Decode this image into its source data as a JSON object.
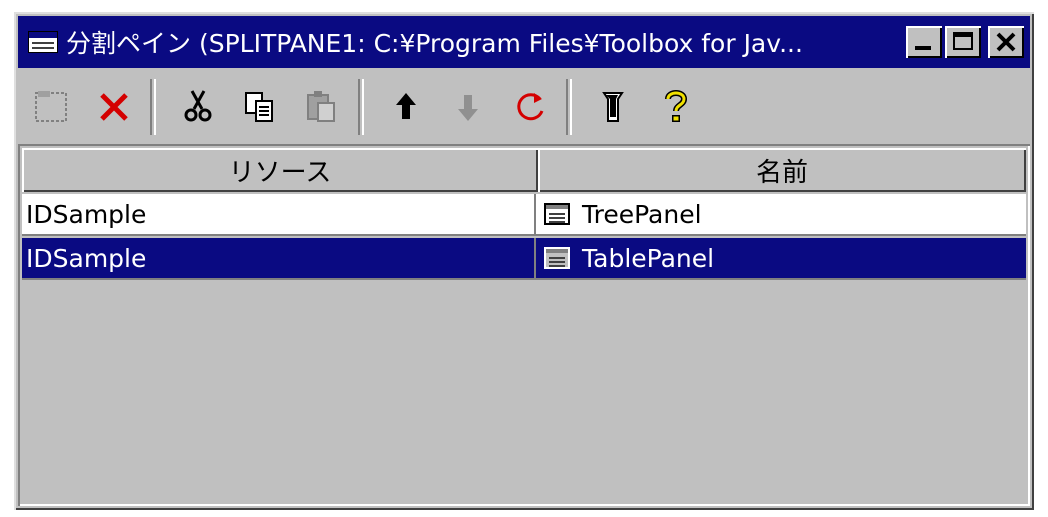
{
  "window": {
    "title": "分割ペイン (SPLITPANE1: C:¥Program Files¥Toolbox for Jav...",
    "buttons": [
      "minimize",
      "maximize",
      "close"
    ]
  },
  "toolbar": {
    "tools": [
      {
        "name": "new-icon",
        "enabled": false
      },
      {
        "name": "delete-icon",
        "enabled": true
      },
      {
        "name": "cut-icon",
        "enabled": true
      },
      {
        "name": "copy-icon",
        "enabled": true
      },
      {
        "name": "paste-icon",
        "enabled": false
      },
      {
        "name": "move-up-icon",
        "enabled": true
      },
      {
        "name": "move-down-icon",
        "enabled": false
      },
      {
        "name": "refresh-icon",
        "enabled": true
      },
      {
        "name": "properties-icon",
        "enabled": true
      },
      {
        "name": "help-icon",
        "enabled": true
      }
    ]
  },
  "table": {
    "columns": [
      "リソース",
      "名前"
    ],
    "rows": [
      {
        "resource": "IDSample",
        "name": "TreePanel",
        "selected": false
      },
      {
        "resource": "IDSample",
        "name": "TablePanel",
        "selected": true
      }
    ]
  },
  "colors": {
    "titlebar": "#0a0a82",
    "selection": "#0a0a82",
    "face": "#c0c0c0"
  }
}
